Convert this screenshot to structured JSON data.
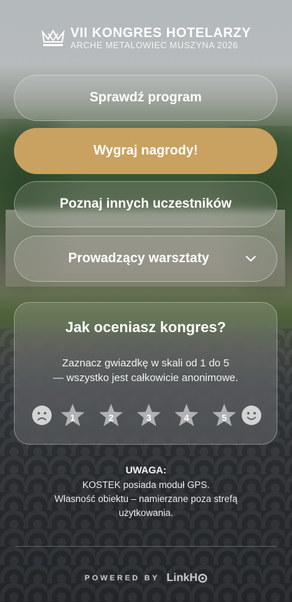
{
  "header": {
    "logo_icon": "crown-logo-icon",
    "title": "VII KONGRES HOTELARZY",
    "subtitle": "ARCHE METALOWIEC MUSZYNA 2026"
  },
  "buttons": [
    {
      "label": "Sprawdź program"
    },
    {
      "label": "Wygraj nagrody!"
    },
    {
      "label": "Poznaj innych uczestników"
    },
    {
      "label": "Prowadzący warsztaty",
      "icon": "chevron-down-icon"
    }
  ],
  "rating": {
    "title": "Jak oceniasz kongres?",
    "line1": "Zaznacz gwiazdkę w skali od 1 do 5",
    "line2": "— wszystko jest całkowicie anonimowe.",
    "left_icon": "sad-face-icon",
    "right_icon": "happy-face-icon",
    "stars": [
      "1",
      "2",
      "3",
      "4",
      "5"
    ]
  },
  "notice": {
    "title": "UWAGA:",
    "line1": "KOSTEK posiada moduł GPS.",
    "line2": "Własność obiektu – namierzane poza strefą",
    "line3": "użytkowania."
  },
  "footer": {
    "powered_text": "POWERED BY",
    "brand": "LinkH"
  },
  "colors": {
    "accent": "#c9a160",
    "glass": "rgba(255,255,255,0.13)"
  }
}
